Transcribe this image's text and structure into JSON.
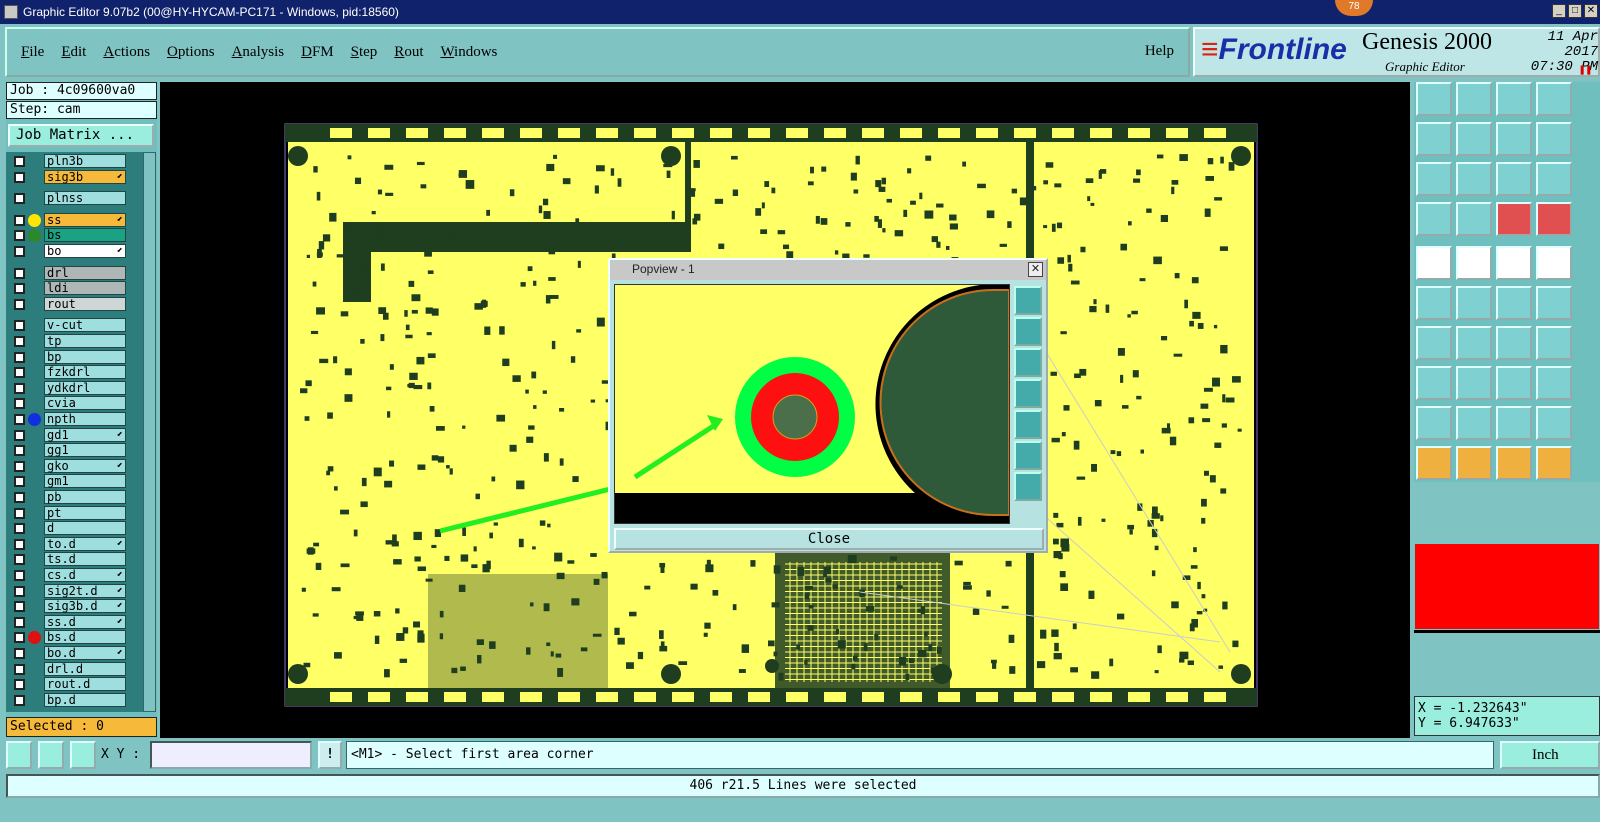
{
  "window": {
    "title": "Graphic Editor 9.07b2 (00@HY-HYCAM-PC171 - Windows, pid:18560)",
    "badge": "78"
  },
  "menu": {
    "items": [
      "File",
      "Edit",
      "Actions",
      "Options",
      "Analysis",
      "DFM",
      "Step",
      "Rout",
      "Windows"
    ],
    "help": "Help"
  },
  "brand": {
    "logo_prefix": "≡",
    "logo": "Frontline",
    "product": "Genesis 2000",
    "subtitle": "Graphic Editor",
    "date": "11 Apr 2017",
    "time": "07:30 PM",
    "pause_icon": "pause-icon"
  },
  "job": {
    "job": "Job : 4c09600va0",
    "step": "Step: cam",
    "matrix_button": "Job Matrix ..."
  },
  "layers": [
    {
      "name": "pln3b",
      "color": "#9fdede",
      "dot": null,
      "gap": false
    },
    {
      "name": "sig3b",
      "color": "#f6b93a",
      "dot": null,
      "gap": false,
      "act": true
    },
    {
      "name": "plnss",
      "color": "#9fdede",
      "dot": null,
      "gap": true
    },
    {
      "name": "ss",
      "color": "#f6b93a",
      "dot": "#ffe600",
      "gap": true,
      "act": true
    },
    {
      "name": "bs",
      "color": "#1aa382",
      "dot": "#2a8a2a",
      "gap": false
    },
    {
      "name": "bo",
      "color": "#ffffff",
      "dot": null,
      "gap": false,
      "act": true
    },
    {
      "name": "drl",
      "color": "#aeb6b6",
      "dot": null,
      "gap": true
    },
    {
      "name": "ldi",
      "color": "#aeb6b6",
      "dot": null,
      "gap": false
    },
    {
      "name": "rout",
      "color": "#cfd6d6",
      "dot": null,
      "gap": false
    },
    {
      "name": "v-cut",
      "color": "#9fdede",
      "dot": null,
      "gap": true
    },
    {
      "name": "tp",
      "color": "#9fdede",
      "dot": null,
      "gap": false
    },
    {
      "name": "bp",
      "color": "#9fdede",
      "dot": null,
      "gap": false
    },
    {
      "name": "fzkdrl",
      "color": "#9fdede",
      "dot": null,
      "gap": false
    },
    {
      "name": "ydkdrl",
      "color": "#9fdede",
      "dot": null,
      "gap": false
    },
    {
      "name": "cvia",
      "color": "#9fdede",
      "dot": null,
      "gap": false
    },
    {
      "name": "npth",
      "color": "#9fdede",
      "dot": "#1030e0",
      "gap": false
    },
    {
      "name": "gd1",
      "color": "#9fdede",
      "dot": null,
      "gap": false,
      "act": true
    },
    {
      "name": "gg1",
      "color": "#9fdede",
      "dot": null,
      "gap": false
    },
    {
      "name": "gko",
      "color": "#9fdede",
      "dot": null,
      "gap": false,
      "act": true
    },
    {
      "name": "gm1",
      "color": "#9fdede",
      "dot": null,
      "gap": false
    },
    {
      "name": "pb",
      "color": "#9fdede",
      "dot": null,
      "gap": false
    },
    {
      "name": "pt",
      "color": "#9fdede",
      "dot": null,
      "gap": false
    },
    {
      "name": "d",
      "color": "#9fdede",
      "dot": null,
      "gap": false
    },
    {
      "name": "to.d",
      "color": "#9fdede",
      "dot": null,
      "gap": false,
      "act": true
    },
    {
      "name": "ts.d",
      "color": "#9fdede",
      "dot": null,
      "gap": false
    },
    {
      "name": "cs.d",
      "color": "#9fdede",
      "dot": null,
      "gap": false,
      "act": true
    },
    {
      "name": "sig2t.d",
      "color": "#9fdede",
      "dot": null,
      "gap": false,
      "act": true
    },
    {
      "name": "sig3b.d",
      "color": "#9fdede",
      "dot": null,
      "gap": false,
      "act": true
    },
    {
      "name": "ss.d",
      "color": "#9fdede",
      "dot": null,
      "gap": false,
      "act": true
    },
    {
      "name": "bs.d",
      "color": "#9fdede",
      "dot": "#e01010",
      "gap": false
    },
    {
      "name": "bo.d",
      "color": "#9fdede",
      "dot": null,
      "gap": false,
      "act": true
    },
    {
      "name": "drl.d",
      "color": "#9fdede",
      "dot": null,
      "gap": false
    },
    {
      "name": "rout.d",
      "color": "#9fdede",
      "dot": null,
      "gap": false
    },
    {
      "name": "bp.d",
      "color": "#9fdede",
      "dot": null,
      "gap": false
    }
  ],
  "selected": "Selected : 0",
  "popview": {
    "title": "Popview - 1",
    "close": "Close"
  },
  "coords": {
    "x": "X = -1.232643\"",
    "y": "Y = 6.947633\""
  },
  "bottom": {
    "xy_label": "X Y :",
    "xy_value": "",
    "prompt": "<M1> - Select first area corner",
    "units": "Inch",
    "excl": "!"
  },
  "status": "406 r21.5 Lines were selected",
  "colors": {
    "board": "#ffff66",
    "copper": "#1f3d1f",
    "pad_ring": "#00ff44",
    "pad": "#ff1010",
    "arrow": "#22ee22"
  },
  "tool_icons": [
    "move-icon",
    "copy-icon",
    "home-icon",
    "zoom-icon",
    "step-icon",
    "feature-icon",
    "scale-icon",
    "measure-icon",
    "select-icon",
    "zoom-fit-icon",
    "one-to-one-icon",
    "help-icon",
    "snap-icon",
    "grid-icon",
    "drc-icon",
    "drc2-icon"
  ]
}
